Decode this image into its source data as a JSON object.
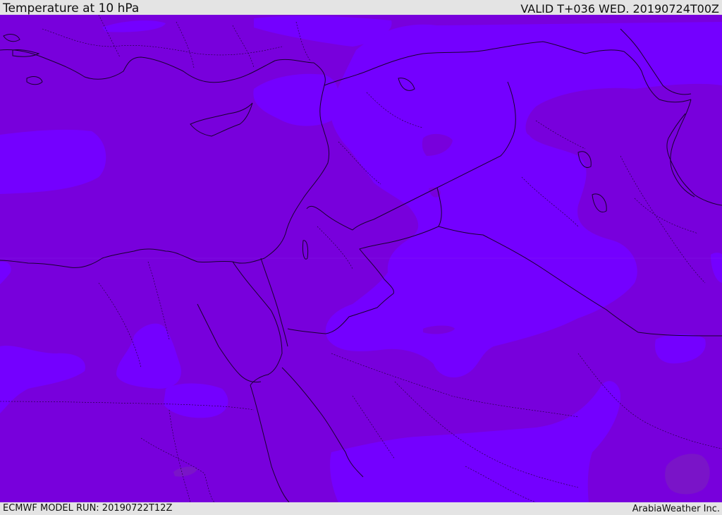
{
  "header": {
    "title": "Temperature at 10 hPa",
    "valid": "VALID T+036 WED. 20190724T00Z"
  },
  "footer": {
    "model_run": "ECMWF MODEL RUN: 20190722T12Z",
    "credit": "ArabiaWeather Inc."
  },
  "map": {
    "colors": {
      "dark": "#7800dc",
      "light": "#7400ff",
      "hotspot": "#7a14c8",
      "lines": "#1a0030"
    }
  }
}
